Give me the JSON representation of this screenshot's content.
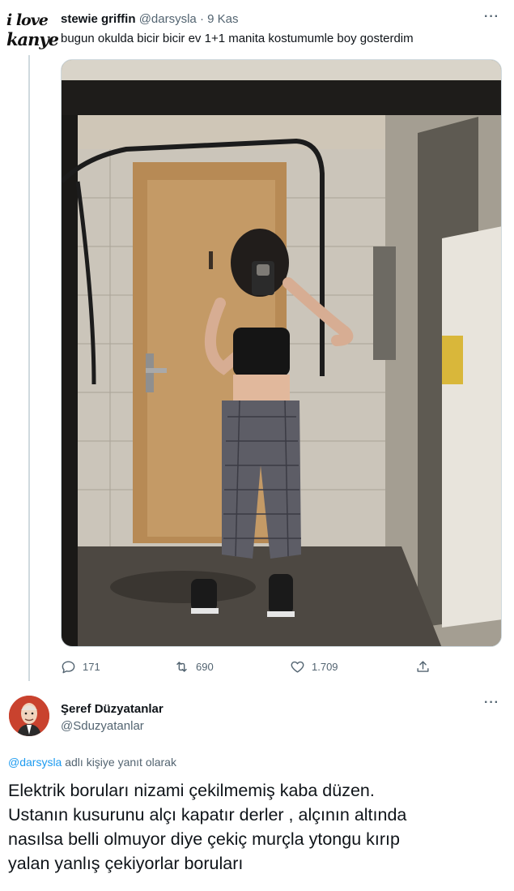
{
  "tweet1": {
    "avatar_text": [
      "i love",
      "kanye"
    ],
    "name": "stewie griffin",
    "handle": "@darsysla",
    "separator": "·",
    "time": "9 Kas",
    "text": "bugun okulda bicir bicir ev 1+1 manita kostumumle boy gosterdim",
    "more": "···",
    "stats": {
      "replies": "171",
      "retweets": "690",
      "likes": "1.709"
    }
  },
  "tweet2": {
    "name": "Şeref Düzyatanlar",
    "handle": "@Sduzyatanlar",
    "more": "···",
    "reply_mention": "@darsysla",
    "reply_suffix": " adlı kişiye yanıt olarak",
    "text_lines": [
      "Elektrik boruları nizami çekilmemiş kaba düzen.",
      "Ustanın kusurunu alçı kapatır derler , alçının altında",
      "nasılsa belli olmuyor diye çekiç murçla ytongu kırıp",
      "yalan yanlış çekiyorlar boruları"
    ]
  },
  "colors": {
    "accent": "#1d9bf0",
    "secondary_text": "#536471",
    "primary_text": "#0f1419",
    "border": "#cfd9de"
  },
  "icons": [
    "reply-icon",
    "retweet-icon",
    "like-icon",
    "share-icon",
    "more-icon"
  ]
}
